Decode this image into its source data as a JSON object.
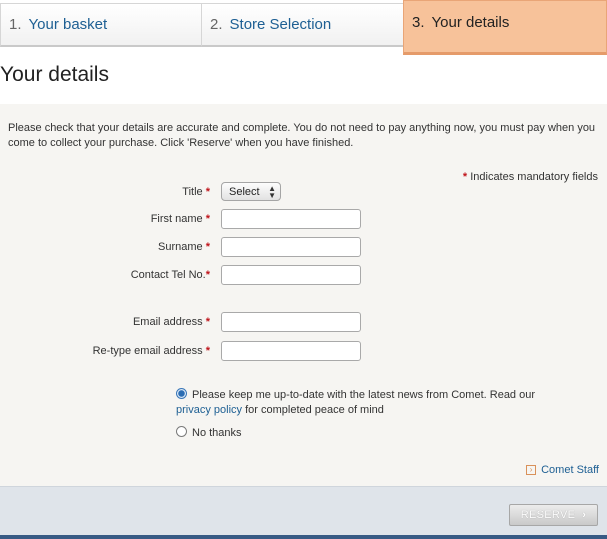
{
  "steps": [
    {
      "num": "1.",
      "label": "Your basket"
    },
    {
      "num": "2.",
      "label": "Store Selection"
    },
    {
      "num": "3.",
      "label": "Your details"
    }
  ],
  "page_title": "Your details",
  "intro": "Please check that your details are accurate and complete. You do not need to pay anything now, you must pay when you come to collect your purchase. Click 'Reserve' when you have finished.",
  "mandatory_note": "Indicates mandatory fields",
  "required_marker": "*",
  "form": {
    "title_label": "Title",
    "title_value": "Select",
    "first_name_label": "First name",
    "surname_label": "Surname",
    "tel_label": "Contact Tel No.",
    "email_label": "Email address",
    "retype_email_label": "Re-type email address"
  },
  "newsletter": {
    "opt_in_text_1": "Please keep me up-to-date with the latest news from Comet. Read our",
    "privacy_link": "privacy policy",
    "opt_in_text_2": "for completed peace of mind",
    "opt_out_text": "No thanks",
    "selected": "opt_in"
  },
  "staff_link": "Comet Staff",
  "reserve_label": "RESERVE",
  "colors": {
    "active_step": "#f7c29a",
    "link": "#1d5f93",
    "required": "#c0141b",
    "footer": "#dfe4ea"
  }
}
